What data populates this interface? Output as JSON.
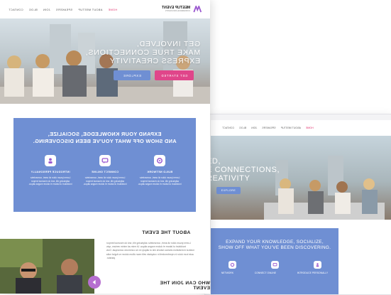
{
  "colors": {
    "accent_pink": "#e0468a",
    "accent_blue": "#6f8fd3",
    "text_dark": "#222222"
  },
  "brand": {
    "name": "MEETUP EVENT",
    "tagline": "CONFERENCE AND EVENTS"
  },
  "nav": {
    "items": [
      "HOME",
      "ABOUT MEETUP",
      "SPEAKERS",
      "JOIN",
      "BLOG",
      "CONTACT"
    ],
    "active": "HOME"
  },
  "hero": {
    "title_lines": [
      "GET INVOLVED,",
      "MAKE TRUE CONNECTIONS,",
      "EXPRESS CREATIVITY"
    ],
    "get_started": "GET STARTED",
    "explore": "EXPLORE"
  },
  "band": {
    "title_lines": [
      "EXPAND YOUR KNOWLEDGE, SOCIALIZE,",
      "AND SHOW OFF WHAT YOU'VE BEEN DISCOVERING."
    ],
    "features": [
      {
        "icon": "network-icon",
        "title": "BUILD NETWORK",
        "desc": "Lorem ipsum dolor sit amet, consectetur adipiscing elit, sed do eiusmod tempor incididunt ut labore et dolore magna aliqua."
      },
      {
        "icon": "chat-icon",
        "title": "CONNECT ONLINE",
        "desc": "Lorem ipsum dolor sit amet, consectetur adipiscing elit, sed do eiusmod tempor incididunt ut labore et dolore magna aliqua."
      },
      {
        "icon": "person-icon",
        "title": "INTRODUCE PERSONALLY",
        "desc": "Lorem ipsum dolor sit amet, consectetur adipiscing elit, sed do eiusmod tempor incididunt ut labore et dolore magna aliqua."
      }
    ]
  },
  "about": {
    "title": "ABOUT THE EVENT",
    "text": "Lorem ipsum dolor sit amet, consectetur adipiscing elit, sed do eiusmod tempor incididunt ut labore et dolore magna aliqua. Ut enim ad minim veniam, quis nostrud exercitation ullamco laboris nisi ut aliquip ex ea commodo consequat. Duis aute irure dolor in reprehenderit in voluptate velit esse cillum dolore eu fugiat nulla pariatur."
  },
  "who": {
    "title": "WHO CAN JOIN THE EVENT"
  },
  "laptop": {
    "nav": [
      "HOME",
      "ABOUT MEETUP",
      "SPEAKERS",
      "JOIN",
      "BLOG",
      "CONTACT"
    ],
    "hero_lines": [
      "ED,",
      "E CONNECTIONS,",
      "REATIVITY"
    ],
    "explore": "EXPLORE",
    "band_lines": [
      "EXPAND YOUR KNOWLEDGE, SOCIALIZE,",
      "SHOW OFF WHAT YOU'VE BEEN DISCOVERING."
    ],
    "features": [
      "NETWORK",
      "CONNECT ONLINE",
      "INTRODUCE PERSONALLY"
    ]
  }
}
